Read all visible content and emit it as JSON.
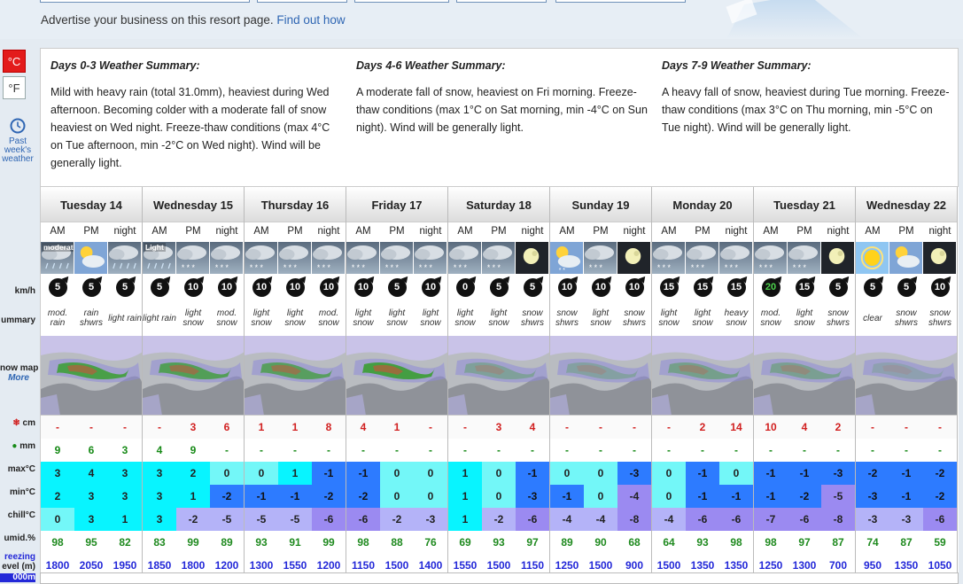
{
  "advert": {
    "text": "Advertise your business on this resort page. ",
    "link": "Find out how"
  },
  "units": {
    "celsius": "°C",
    "fahrenheit": "°F"
  },
  "history": {
    "line1": "Past",
    "line2": "week's",
    "line3": "weather"
  },
  "row_labels": {
    "wind": "km/h",
    "summary": "ummary",
    "snowmap": "now map",
    "more": "More",
    "snow": "cm",
    "rain": "mm",
    "max": "max°C",
    "min": "min°C",
    "chill": "chill°C",
    "humid": "umid.%",
    "freezing1": "reezing",
    "freezing2": "evel (m)",
    "bottom": "000m"
  },
  "summaries": [
    {
      "title": "Days 0-3 Weather Summary:",
      "text": "Mild with heavy rain (total 31.0mm), heaviest during Wed afternoon. Becoming colder with a moderate fall of snow heaviest on Wed night. Freeze-thaw conditions (max 4°C on Tue afternoon, min -2°C on Wed night). Wind will be generally light."
    },
    {
      "title": "Days 4-6 Weather Summary:",
      "text": "A moderate fall of snow, heaviest on Fri morning. Freeze-thaw conditions (max 1°C on Sat morning, min -4°C on Sun night). Wind will be generally light."
    },
    {
      "title": "Days 7-9 Weather Summary:",
      "text": "A heavy fall of snow, heaviest during Tue morning. Freeze-thaw conditions (max 3°C on Thu morning, min -5°C on Tue night). Wind will be generally light."
    }
  ],
  "period_labels": [
    "AM",
    "PM",
    "night"
  ],
  "days": [
    {
      "name": "Tuesday 14",
      "wx": [
        "rain",
        "cloud-sun",
        "rain"
      ],
      "wxlabel": [
        "moderate",
        "",
        ""
      ],
      "wind": [
        "5",
        "5",
        "5"
      ],
      "summary": [
        "mod. rain",
        "rain shwrs",
        "light rain"
      ],
      "snow": [
        "-",
        "-",
        "-"
      ],
      "rain": [
        "9",
        "6",
        "3"
      ],
      "max": [
        "3",
        "4",
        "3"
      ],
      "min": [
        "2",
        "3",
        "3"
      ],
      "chill": [
        "0",
        "3",
        "1"
      ],
      "humid": [
        "98",
        "95",
        "82"
      ],
      "freezing": [
        "1800",
        "2050",
        "1950"
      ]
    },
    {
      "name": "Wednesday 15",
      "wx": [
        "rain",
        "snow",
        "snow"
      ],
      "wxlabel": [
        "Light",
        "",
        ""
      ],
      "wind": [
        "5",
        "10",
        "10"
      ],
      "summary": [
        "light rain",
        "light snow",
        "mod. snow"
      ],
      "snow": [
        "-",
        "3",
        "6"
      ],
      "rain": [
        "4",
        "9",
        "-"
      ],
      "max": [
        "3",
        "2",
        "0"
      ],
      "min": [
        "3",
        "1",
        "-2"
      ],
      "chill": [
        "3",
        "-2",
        "-5"
      ],
      "humid": [
        "83",
        "99",
        "89"
      ],
      "freezing": [
        "1850",
        "1800",
        "1200"
      ]
    },
    {
      "name": "Thursday 16",
      "wx": [
        "snow",
        "snow",
        "snow"
      ],
      "wxlabel": [
        "",
        "",
        ""
      ],
      "wind": [
        "10",
        "10",
        "10"
      ],
      "summary": [
        "light snow",
        "light snow",
        "mod. snow"
      ],
      "snow": [
        "1",
        "1",
        "8"
      ],
      "rain": [
        "-",
        "-",
        "-"
      ],
      "max": [
        "0",
        "1",
        "-1"
      ],
      "min": [
        "-1",
        "-1",
        "-2"
      ],
      "chill": [
        "-5",
        "-5",
        "-6"
      ],
      "humid": [
        "93",
        "91",
        "99"
      ],
      "freezing": [
        "1300",
        "1550",
        "1200"
      ]
    },
    {
      "name": "Friday 17",
      "wx": [
        "snow",
        "snow",
        "snow"
      ],
      "wxlabel": [
        "",
        "",
        ""
      ],
      "wind": [
        "10",
        "5",
        "10"
      ],
      "summary": [
        "light snow",
        "light snow",
        "light snow"
      ],
      "snow": [
        "4",
        "1",
        "-"
      ],
      "rain": [
        "-",
        "-",
        "-"
      ],
      "max": [
        "-1",
        "0",
        "0"
      ],
      "min": [
        "-2",
        "0",
        "0"
      ],
      "chill": [
        "-6",
        "-2",
        "-3"
      ],
      "humid": [
        "98",
        "88",
        "76"
      ],
      "freezing": [
        "1150",
        "1500",
        "1400"
      ]
    },
    {
      "name": "Saturday 18",
      "wx": [
        "snow",
        "snow",
        "moon"
      ],
      "wxlabel": [
        "",
        "",
        ""
      ],
      "wind": [
        "0",
        "5",
        "5"
      ],
      "summary": [
        "light snow",
        "light snow",
        "snow shwrs"
      ],
      "snow": [
        "-",
        "3",
        "4"
      ],
      "rain": [
        "-",
        "-",
        "-"
      ],
      "max": [
        "1",
        "0",
        "-1"
      ],
      "min": [
        "1",
        "0",
        "-3"
      ],
      "chill": [
        "1",
        "-2",
        "-6"
      ],
      "humid": [
        "69",
        "93",
        "97"
      ],
      "freezing": [
        "1550",
        "1500",
        "1150"
      ]
    },
    {
      "name": "Sunday 19",
      "wx": [
        "sun-snow",
        "snow",
        "moon"
      ],
      "wxlabel": [
        "",
        "",
        ""
      ],
      "wind": [
        "10",
        "10",
        "10"
      ],
      "summary": [
        "snow shwrs",
        "light snow",
        "snow shwrs"
      ],
      "snow": [
        "-",
        "-",
        "-"
      ],
      "rain": [
        "-",
        "-",
        "-"
      ],
      "max": [
        "0",
        "0",
        "-3"
      ],
      "min": [
        "-1",
        "0",
        "-4"
      ],
      "chill": [
        "-4",
        "-4",
        "-8"
      ],
      "humid": [
        "89",
        "90",
        "68"
      ],
      "freezing": [
        "1250",
        "1500",
        "900"
      ]
    },
    {
      "name": "Monday 20",
      "wx": [
        "snow",
        "snow",
        "snow"
      ],
      "wxlabel": [
        "",
        "",
        ""
      ],
      "wind": [
        "15",
        "15",
        "15"
      ],
      "summary": [
        "light snow",
        "light snow",
        "heavy snow"
      ],
      "snow": [
        "-",
        "2",
        "14"
      ],
      "rain": [
        "-",
        "-",
        "-"
      ],
      "max": [
        "0",
        "-1",
        "0"
      ],
      "min": [
        "0",
        "-1",
        "-1"
      ],
      "chill": [
        "-4",
        "-6",
        "-6"
      ],
      "humid": [
        "64",
        "93",
        "98"
      ],
      "freezing": [
        "1500",
        "1350",
        "1350"
      ]
    },
    {
      "name": "Tuesday 21",
      "wx": [
        "snow",
        "snow",
        "moon"
      ],
      "wxlabel": [
        "",
        "",
        ""
      ],
      "wind": [
        "20",
        "15",
        "5"
      ],
      "summary": [
        "mod. snow",
        "light snow",
        "snow shwrs"
      ],
      "snow": [
        "10",
        "4",
        "2"
      ],
      "rain": [
        "-",
        "-",
        "-"
      ],
      "max": [
        "-1",
        "-1",
        "-3"
      ],
      "min": [
        "-1",
        "-2",
        "-5"
      ],
      "chill": [
        "-7",
        "-6",
        "-8"
      ],
      "humid": [
        "98",
        "97",
        "87"
      ],
      "freezing": [
        "1250",
        "1300",
        "700"
      ]
    },
    {
      "name": "Wednesday 22",
      "wx": [
        "sun",
        "cloud-sun",
        "moon"
      ],
      "wxlabel": [
        "",
        "",
        ""
      ],
      "wind": [
        "5",
        "5",
        "10"
      ],
      "summary": [
        "clear",
        "snow shwrs",
        "snow shwrs"
      ],
      "snow": [
        "-",
        "-",
        "-"
      ],
      "rain": [
        "-",
        "-",
        "-"
      ],
      "max": [
        "-2",
        "-1",
        "-2"
      ],
      "min": [
        "-3",
        "-1",
        "-2"
      ],
      "chill": [
        "-3",
        "-3",
        "-6"
      ],
      "humid": [
        "74",
        "87",
        "59"
      ],
      "freezing": [
        "950",
        "1350",
        "1050"
      ]
    }
  ]
}
